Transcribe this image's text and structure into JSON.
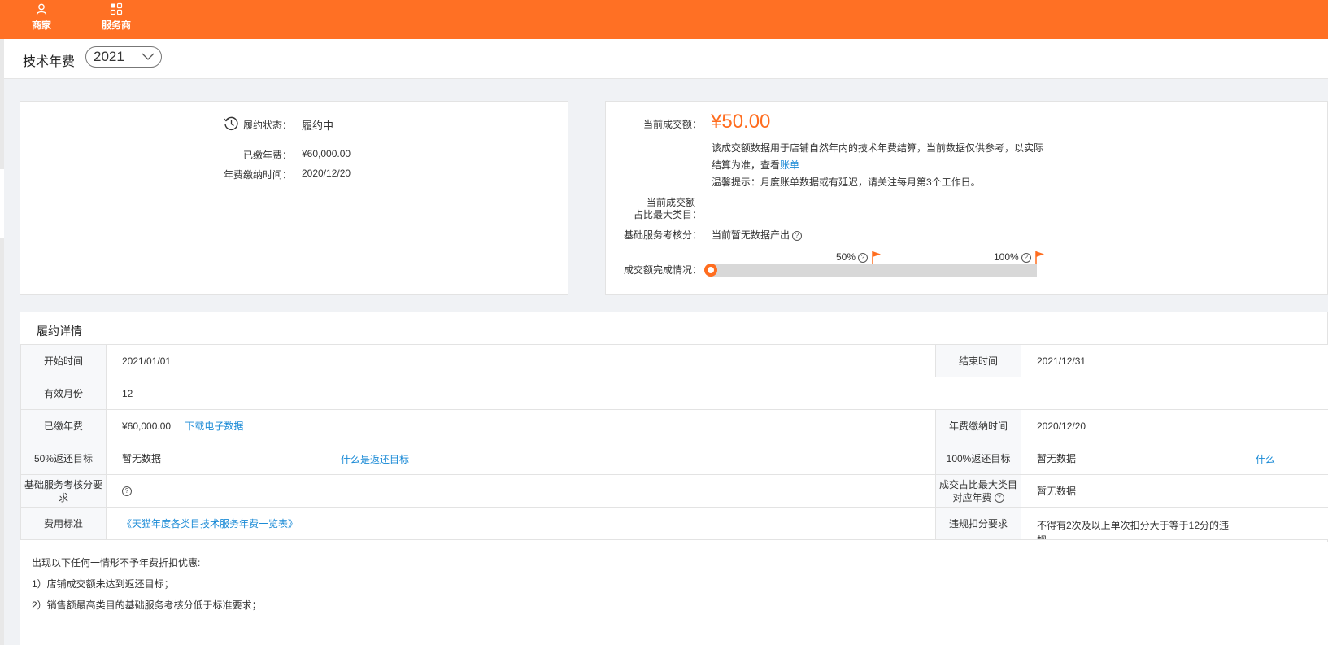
{
  "nav": {
    "merchant": "商家",
    "service_provider": "服务商"
  },
  "header": {
    "title": "技术年费",
    "year": "2021"
  },
  "contract_card": {
    "status_label": "履约状态：",
    "status_value": "履约中",
    "paid_fee_label": "已缴年费：",
    "paid_fee_value": "¥60,000.00",
    "pay_time_label": "年费缴纳时间：",
    "pay_time_value": "2020/12/20"
  },
  "sales_card": {
    "current_sales_label": "当前成交额：",
    "current_sales_value": "¥50.00",
    "desc_line1": "该成交额数据用于店铺自然年内的技术年费结算，当前数据仅供参考，以实际",
    "desc_line2": "结算为准，查看",
    "bill_link": "账单",
    "tip": "温馨提示：月度账单数据或有延迟，请关注每月第3个工作日。",
    "max_category_label_1": "当前成交额",
    "max_category_label_2": "占比最大类目：",
    "score_label": "基础服务考核分：",
    "score_value": "当前暂无数据产出",
    "completion_label": "成交额完成情况：",
    "milestone_50": "50%",
    "milestone_100": "100%",
    "progress_fraction": 0.0
  },
  "details": {
    "title": "履约详情",
    "start_label": "开始时间",
    "start_value": "2021/01/01",
    "end_label": "结束时间",
    "end_value": "2021/12/31",
    "months_label": "有效月份",
    "months_value": "12",
    "paid_label": "已缴年费",
    "paid_value": "¥60,000.00",
    "download_link": "下载电子数据",
    "pay_time_label": "年费缴纳时间",
    "pay_time_value": "2020/12/20",
    "target50_label": "50%返还目标",
    "target50_value": "暂无数据",
    "what_is_target_link": "什么是返还目标",
    "target100_label": "100%返还目标",
    "target100_value": "暂无数据",
    "target100_link_partial": "什么",
    "score_req_label_1": "基础服务考核分要",
    "score_req_label_2": "求",
    "max_cat_fee_label_1": "成交占比最大类目",
    "max_cat_fee_label_2": "对应年费",
    "max_cat_fee_value": "暂无数据",
    "fee_standard_label": "费用标准",
    "fee_standard_link": "《天猫年度各类目技术服务年费一览表》",
    "violation_label": "违规扣分要求",
    "violation_value_1": "不得有2次及以上单次扣分大于等于12分的违",
    "violation_value_2": "规"
  },
  "notes": {
    "intro": "出现以下任何一情形不予年费折扣优惠:",
    "item1": "1）店铺成交额未达到返还目标；",
    "item2": "2）销售额最高类目的基础服务考核分低于标准要求；"
  },
  "colors": {
    "brand": "#ff7024",
    "price": "#ff6d1f",
    "link": "#1a8ad6"
  }
}
